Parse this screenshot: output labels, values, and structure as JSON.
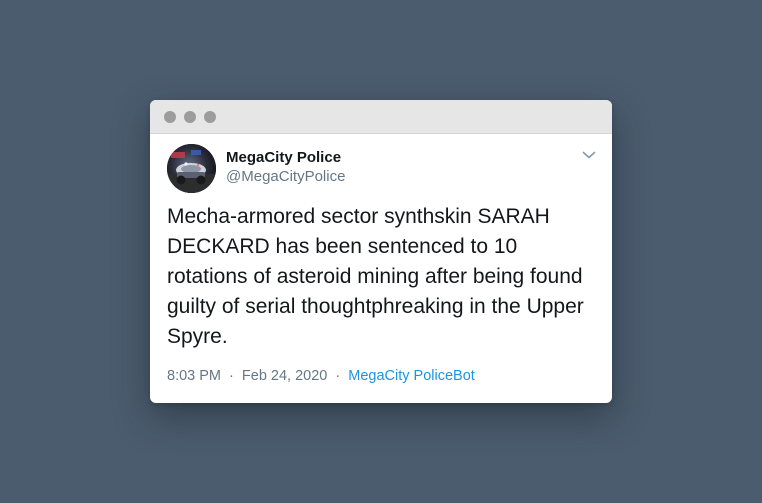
{
  "tweet": {
    "display_name": "MegaCity Police",
    "handle": "@MegaCityPolice",
    "text": "Mecha-armored sector synthskin SARAH DECKARD has been sentenced to 10 rotations of asteroid mining after being found guilty of serial thoughtphreaking in the Upper Spyre.",
    "time": "8:03 PM",
    "date": "Feb 24, 2020",
    "separator": "·",
    "source": "MegaCity PoliceBot",
    "menu_icon": "chevron-down-icon"
  },
  "colors": {
    "background": "#4b5c6e",
    "titlebar": "#e6e6e6",
    "window_dots": "#9c9c9c",
    "text_primary": "#14171a",
    "text_secondary": "#657786",
    "link": "#1b95e0"
  }
}
